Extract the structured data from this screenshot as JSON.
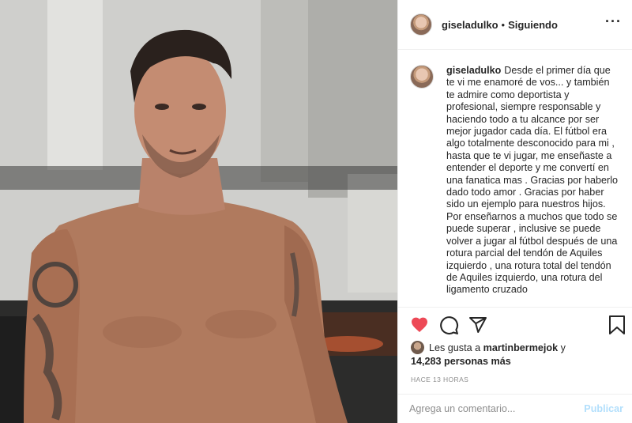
{
  "post": {
    "username": "giseladulko",
    "dot": "•",
    "follow_state": "Siguiendo",
    "more_label": "···",
    "caption_user": "giseladulko",
    "caption_text": "Desde el primer día que te vi me enamoré de vos... y también te admire como deportista y profesional, siempre responsable y haciendo todo a tu alcance por ser mejor jugador cada día. El fútbol era algo totalmente desconocido para mi , hasta que te vi jugar, me enseñaste a entender el deporte y me convertí en una fanatica mas . Gracias por haberlo dado todo amor . Gracias por haber sido un ejemplo para nuestros hijos. Por enseñarnos a muchos que todo se puede superar , inclusive se puede volver a jugar al fútbol después de una rotura parcial del tendón de Aquiles izquierdo , una rotura total del tendón de Aquiles izquierdo, una rotura del ligamento cruzado",
    "likes_prefix": "Les gusta a",
    "likes_user": "martinbermejok",
    "likes_conj": "y",
    "likes_count": "14,283 personas más",
    "time_ago": "HACE 13 HORAS"
  },
  "comment": {
    "placeholder": "Agrega un comentario...",
    "post_label": "Publicar"
  },
  "icons": {
    "like": "heart-icon",
    "comment": "comment-icon",
    "share": "share-icon",
    "save": "bookmark-icon"
  },
  "colors": {
    "like_active": "#ed4956",
    "post_button_disabled": "#b2dffc",
    "secondary_text": "#8e8e8e"
  }
}
